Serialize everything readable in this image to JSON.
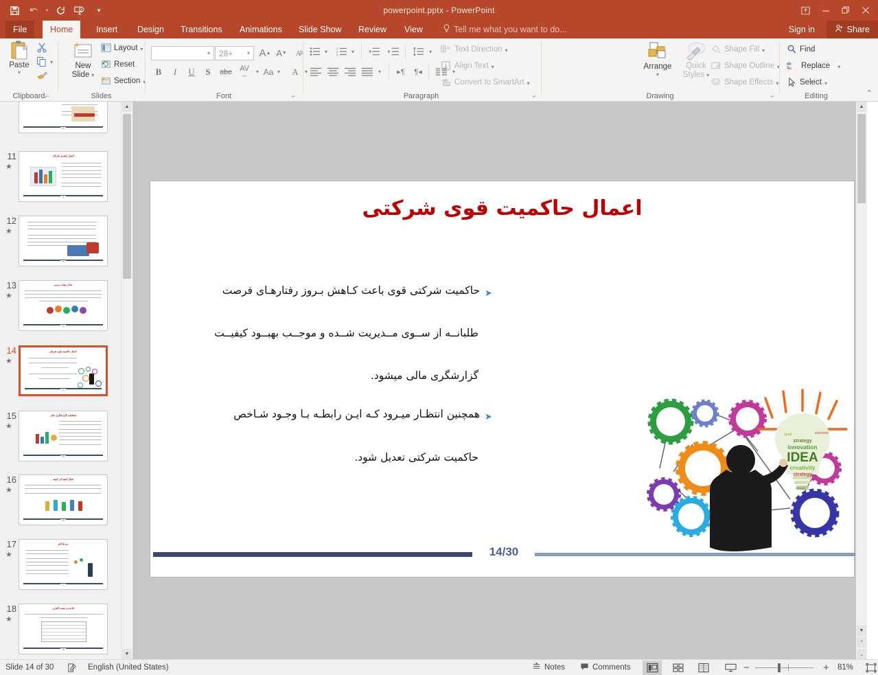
{
  "window": {
    "title": "powerpoint.pptx - PowerPoint",
    "quick_access": [
      "save-icon",
      "undo-icon",
      "redo-icon",
      "start-slideshow-icon",
      "customize-qat-icon"
    ],
    "controls": [
      "ribbon-display-options-icon",
      "minimize-icon",
      "restore-icon",
      "close-icon"
    ]
  },
  "ribbon": {
    "tabs": [
      {
        "label": "File"
      },
      {
        "label": "Home"
      },
      {
        "label": "Insert"
      },
      {
        "label": "Design"
      },
      {
        "label": "Transitions"
      },
      {
        "label": "Animations"
      },
      {
        "label": "Slide Show"
      },
      {
        "label": "Review"
      },
      {
        "label": "View"
      }
    ],
    "active_tab": "Home",
    "tell_me": "Tell me what you want to do...",
    "sign_in": "Sign in",
    "share": "Share",
    "groups": {
      "clipboard": {
        "label": "Clipboard",
        "paste": "Paste",
        "cut": "cut-icon",
        "copy": "copy-icon",
        "format_painter": "format-painter-icon"
      },
      "slides": {
        "label": "Slides",
        "new_slide": "New\nSlide",
        "new_slide_line1": "New",
        "new_slide_line2": "Slide",
        "layout": "Layout",
        "reset": "Reset",
        "section": "Section"
      },
      "font": {
        "label": "Font",
        "font_name": "",
        "font_size": "28+",
        "grow": "A",
        "shrink": "A",
        "clear_formatting": "clear-formatting-icon",
        "bold": "B",
        "italic": "I",
        "underline": "U",
        "shadow": "S",
        "strikethrough": "abc",
        "char_spacing": "AV",
        "change_case": "Aa",
        "font_color": "A"
      },
      "paragraph": {
        "label": "Paragraph",
        "text_direction": "Text Direction",
        "align_text": "Align Text",
        "convert_smartart": "Convert to SmartArt"
      },
      "drawing": {
        "label": "Drawing",
        "arrange": "Arrange",
        "quick_styles_line1": "Quick",
        "quick_styles_line2": "Styles",
        "shape_fill": "Shape Fill",
        "shape_outline": "Shape Outline",
        "shape_effects": "Shape Effects"
      },
      "editing": {
        "label": "Editing",
        "find": "Find",
        "replace": "Replace",
        "select": "Select"
      }
    }
  },
  "slide_panel": {
    "thumbnails": [
      {
        "number": "10",
        "title": "",
        "selected": false,
        "partial": true
      },
      {
        "number": "11",
        "title": "اصول راهبری شرکتی",
        "selected": false
      },
      {
        "number": "12",
        "title": "",
        "selected": false
      },
      {
        "number": "13",
        "title": "تعادل هیات مدیره",
        "selected": false
      },
      {
        "number": "14",
        "title": "اعمال حاکمیت قوی شرکتی",
        "selected": true
      },
      {
        "number": "15",
        "title": "شفافیت گزارشگری مالی",
        "selected": false
      },
      {
        "number": "16",
        "title": "فعال کمیته ای کمیته",
        "selected": false
      },
      {
        "number": "17",
        "title": "ریز پاداش",
        "selected": false
      },
      {
        "number": "18",
        "title": "قاعده و نسبت گذاری",
        "selected": false
      }
    ]
  },
  "slide": {
    "title": "اعمال حاکمیت قوی شرکتی",
    "bullets": [
      {
        "marker": "➤",
        "lines": [
          "حاکمیت شرکتی قوی باعث کـاهش بـروز رفتارهـای فرصت",
          "طلبانــه از ســوی مــدیریت شــده و موجــب بهبــود کیفیــت",
          "گزارشگری مالی میشود."
        ]
      },
      {
        "marker": "➤",
        "lines": [
          "همچنین انتظـار میـرود کـه ایـن رابطـه بـا وجـود شـاخص",
          "حاکمیت شرکتی تعدیل شود."
        ]
      }
    ],
    "footer_number": "14/30",
    "image_alt": "gears-and-businessman-idea-illustration",
    "image_word": "IDEA"
  },
  "status_bar": {
    "slide_counter": "Slide 14 of 30",
    "spellcheck_icon": "spellcheck-icon",
    "language": "English (United States)",
    "notes": "Notes",
    "comments": "Comments",
    "views": [
      "normal-view-icon",
      "slide-sorter-icon",
      "reading-view-icon",
      "slideshow-view-icon"
    ],
    "active_view": "normal-view-icon",
    "zoom_out": "−",
    "zoom_in": "+",
    "zoom_level": "81%",
    "fit_slide": "fit-slide-icon"
  },
  "colors": {
    "accent": "#b7472a",
    "file_tab": "#a33d22",
    "title_red": "#c00000",
    "selected_thumb": "#d6512b",
    "footer_dark": "#3b4a6b",
    "footer_light": "#8a9bc2",
    "page_num": "#4a5f96"
  }
}
